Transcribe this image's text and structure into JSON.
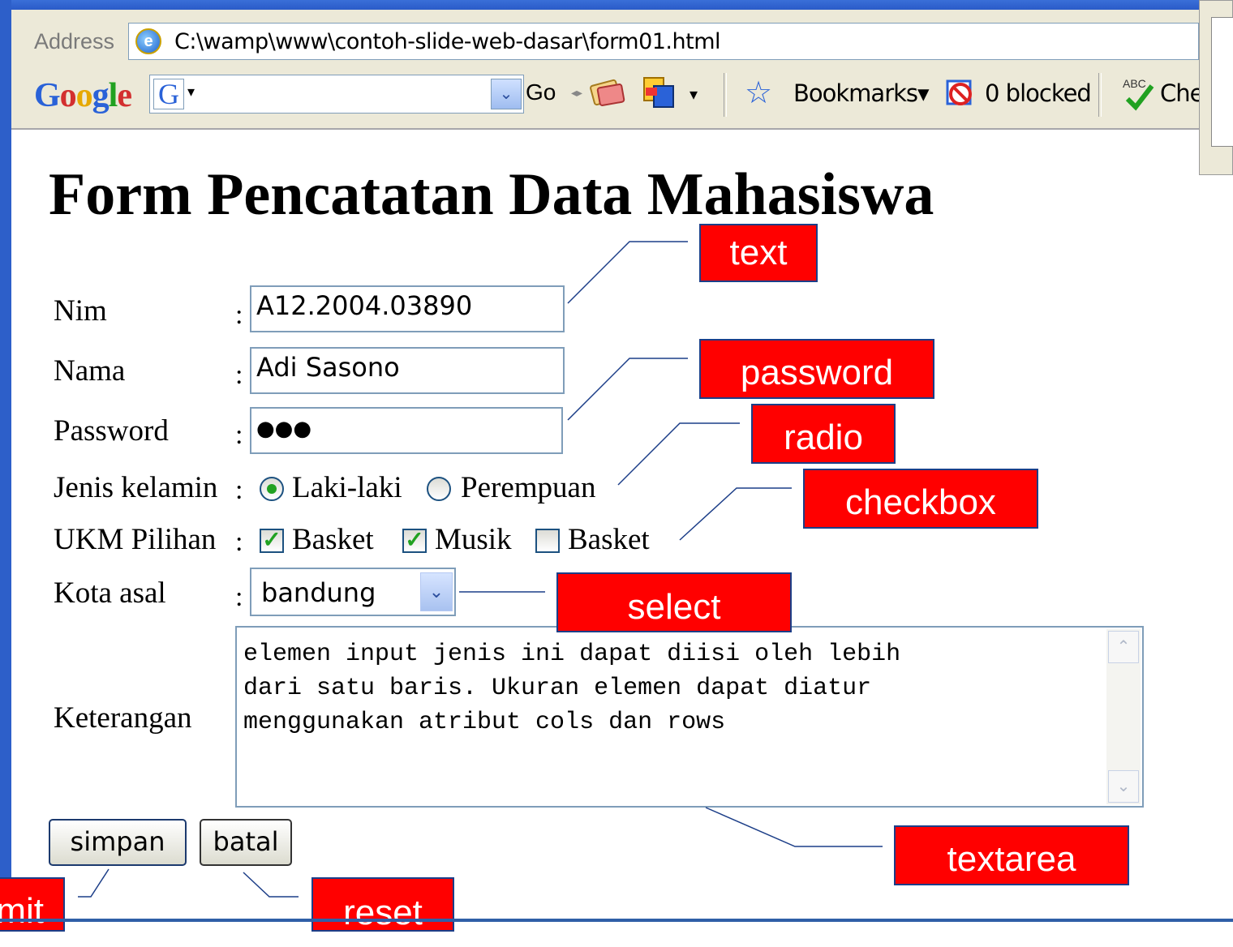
{
  "browser": {
    "address_label": "Address",
    "address_value": "C:\\wamp\\www\\contoh-slide-web-dasar\\form01.html",
    "google_toolbar": {
      "logo": "Google",
      "search_letter": "G",
      "go_label": "Go",
      "bookmarks_label": "Bookmarks",
      "blocked_label": "0 blocked",
      "check_label": "Chec",
      "check_icon_text": "ABC"
    }
  },
  "form": {
    "title": "Form Pencatatan Data Mahasiswa",
    "colon": ":",
    "nim": {
      "label": "Nim",
      "value": "A12.2004.03890"
    },
    "nama": {
      "label": "Nama",
      "value": "Adi Sasono"
    },
    "password": {
      "label": "Password",
      "value": "●●●"
    },
    "gender": {
      "label": "Jenis kelamin",
      "options": [
        {
          "label": "Laki-laki",
          "checked": true
        },
        {
          "label": "Perempuan",
          "checked": false
        }
      ]
    },
    "ukm": {
      "label": "UKM Pilihan",
      "options": [
        {
          "label": "Basket",
          "checked": true
        },
        {
          "label": "Musik",
          "checked": true
        },
        {
          "label": "Basket",
          "checked": false
        }
      ]
    },
    "kota": {
      "label": "Kota asal",
      "selected": "bandung"
    },
    "keterangan": {
      "label": "Keterangan",
      "value": "elemen input jenis ini dapat diisi oleh lebih\ndari satu baris. Ukuran elemen dapat diatur\nmenggunakan atribut cols dan rows"
    },
    "submit_label": "simpan",
    "reset_label": "batal"
  },
  "callouts": {
    "text": "text",
    "password": "password",
    "radio": "radio",
    "checkbox": "checkbox",
    "select": "select",
    "textarea": "textarea",
    "submit": "mit",
    "reset": "reset"
  },
  "colors": {
    "callout_bg": "#ff0000",
    "callout_border": "#1c3e88",
    "input_border": "#7f9db9",
    "xp_blue": "#2d5fc9"
  }
}
